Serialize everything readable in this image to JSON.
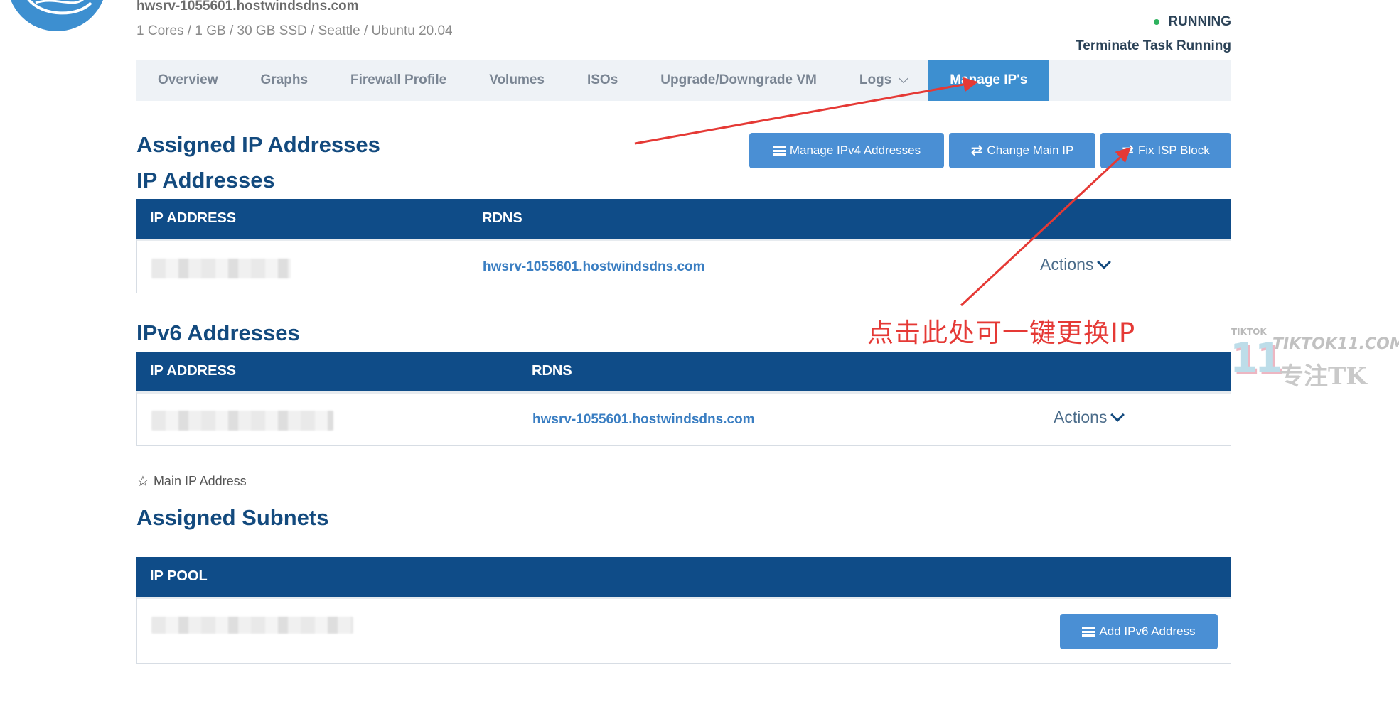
{
  "server": {
    "hostname": "hwsrv-1055601.hostwindsdns.com",
    "specs": "1 Cores / 1 GB / 30 GB SSD / Seattle / Ubuntu 20.04",
    "status": "RUNNING",
    "status_color": "#2eb25e",
    "task": "Terminate Task Running"
  },
  "tabs": [
    {
      "label": "Overview"
    },
    {
      "label": "Graphs"
    },
    {
      "label": "Firewall Profile"
    },
    {
      "label": "Volumes"
    },
    {
      "label": "ISOs"
    },
    {
      "label": "Upgrade/Downgrade VM"
    },
    {
      "label": "Logs"
    },
    {
      "label": "Manage IP's",
      "active": true
    }
  ],
  "assigned": {
    "title": "Assigned IP Addresses",
    "buttons": {
      "manage_ipv4": "Manage IPv4 Addresses",
      "change_main": "Change Main IP",
      "fix_isp": "Fix ISP Block"
    }
  },
  "ipv4": {
    "title": "IP Addresses",
    "col_ip": "IP ADDRESS",
    "col_rdns": "RDNS",
    "rows": [
      {
        "rdns": "hwsrv-1055601.hostwindsdns.com",
        "actions": "Actions"
      }
    ]
  },
  "ipv6": {
    "title": "IPv6 Addresses",
    "col_ip": "IP ADDRESS",
    "col_rdns": "RDNS",
    "rows": [
      {
        "rdns": "hwsrv-1055601.hostwindsdns.com",
        "actions": "Actions"
      }
    ]
  },
  "legend": {
    "main_ip": "Main IP Address"
  },
  "subnets": {
    "title": "Assigned Subnets",
    "col_pool": "IP POOL",
    "add_button": "Add IPv6 Address"
  },
  "annotation": {
    "text": "点击此处可一键更换IP",
    "color": "#e53935"
  },
  "watermark": {
    "small": "TIKTOK",
    "number": "11",
    "domain": "TIKTOK11.COM",
    "tagline": "专注TK"
  },
  "colors": {
    "accent": "#3d8fd0",
    "table_header": "#0f4c88",
    "heading": "#134a7e",
    "button": "#4a8fd4"
  }
}
